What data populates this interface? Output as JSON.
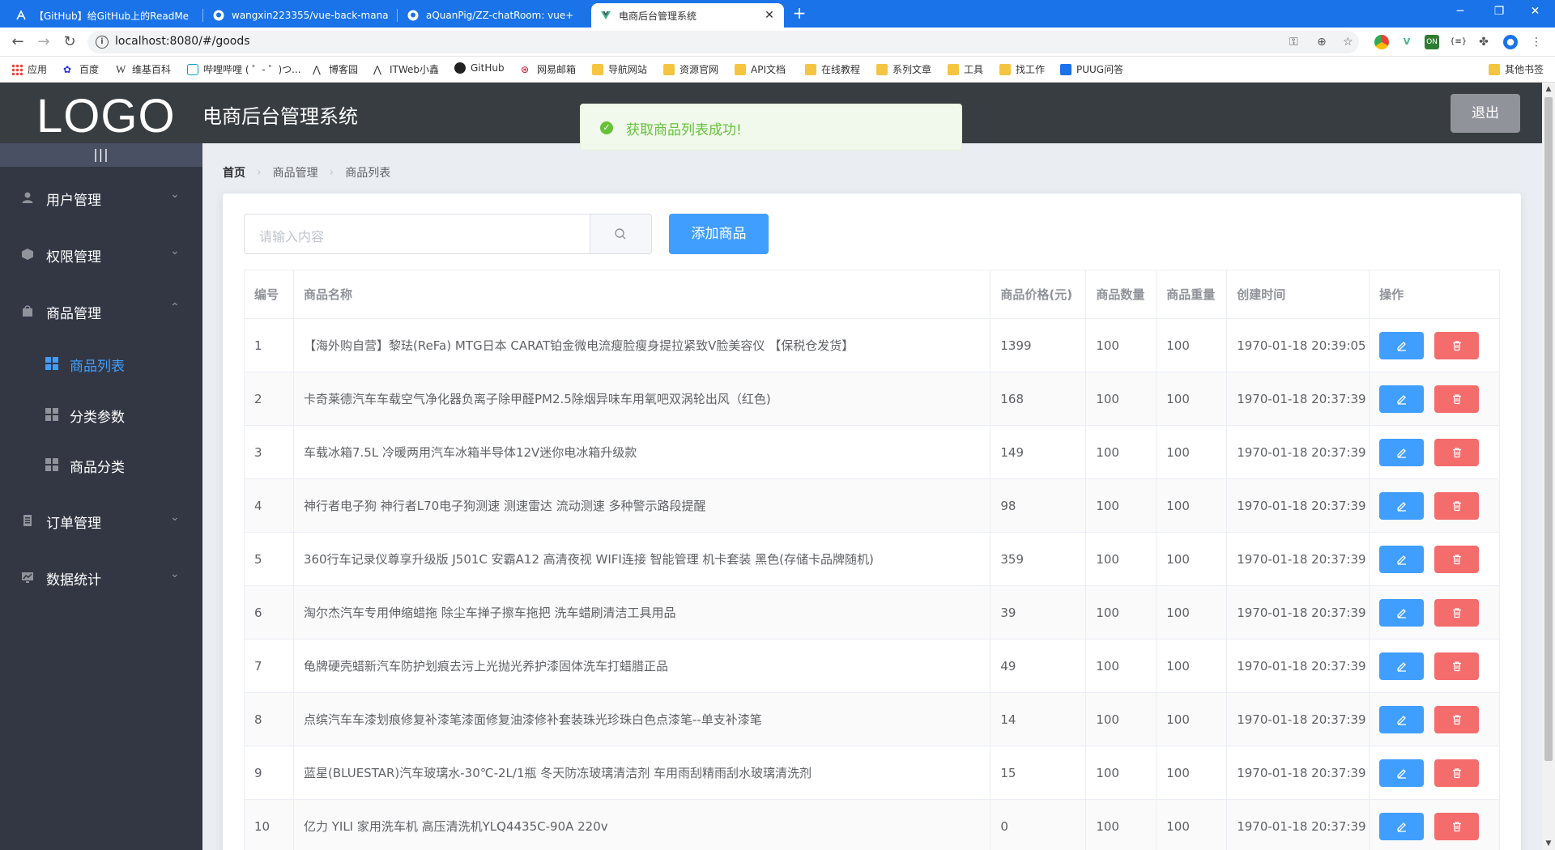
{
  "browser": {
    "tabs": [
      {
        "title": "【GitHub】给GitHub上的ReadMe",
        "icon": "aquanpig-icon",
        "active": false
      },
      {
        "title": "wangxin223355/vue-back-mana",
        "icon": "github-icon",
        "active": false
      },
      {
        "title": "aQuanPig/ZZ-chatRoom: vue+",
        "icon": "github-icon",
        "active": false
      },
      {
        "title": "电商后台管理系统",
        "icon": "vue-icon",
        "active": true
      }
    ],
    "new_tab": "+",
    "url": "localhost:8080/#/goods",
    "bookmarks": [
      {
        "label": "应用",
        "icon": "apps-icon"
      },
      {
        "label": "百度",
        "icon": "baidu-icon"
      },
      {
        "label": "维基百科",
        "icon": "wikipedia-icon"
      },
      {
        "label": "哔哩哔哩 ( ゜- ゜)つ...",
        "icon": "bilibili-icon"
      },
      {
        "label": "博客园",
        "icon": "cnblogs-icon"
      },
      {
        "label": "ITWeb小鑫",
        "icon": "itweb-icon"
      },
      {
        "label": "GitHub",
        "icon": "github-icon"
      },
      {
        "label": "网易邮箱",
        "icon": "netease-mail-icon"
      },
      {
        "label": "导航网站",
        "icon": "folder-icon"
      },
      {
        "label": "资源官网",
        "icon": "folder-icon"
      },
      {
        "label": "API文档",
        "icon": "folder-icon"
      },
      {
        "label": "在线教程",
        "icon": "folder-icon"
      },
      {
        "label": "系列文章",
        "icon": "folder-icon"
      },
      {
        "label": "工具",
        "icon": "folder-icon"
      },
      {
        "label": "找工作",
        "icon": "folder-icon"
      },
      {
        "label": "PUUG问答",
        "icon": "puug-icon"
      }
    ],
    "other_bookmarks": "其他书签"
  },
  "header": {
    "logo": "LOGO",
    "title": "电商后台管理系统",
    "logout": "退出"
  },
  "toast": {
    "message": "获取商品列表成功!",
    "color": "#67c23a"
  },
  "sidebar": {
    "toggle": "|||",
    "menus": [
      {
        "label": "用户管理",
        "icon": "user-icon",
        "arrow": "⌄"
      },
      {
        "label": "权限管理",
        "icon": "box-icon",
        "arrow": "⌄"
      },
      {
        "label": "商品管理",
        "icon": "bag-icon",
        "arrow": "⌃"
      },
      {
        "label": "订单管理",
        "icon": "document-icon",
        "arrow": "⌄"
      },
      {
        "label": "数据统计",
        "icon": "chart-icon",
        "arrow": "⌄"
      }
    ],
    "submenus": [
      {
        "label": "商品列表",
        "active": true
      },
      {
        "label": "分类参数",
        "active": false
      },
      {
        "label": "商品分类",
        "active": false
      }
    ],
    "active_color": "#409eff"
  },
  "breadcrumb": [
    "首页",
    "商品管理",
    "商品列表"
  ],
  "toolbar": {
    "search_placeholder": "请输入内容",
    "add_label": "添加商品"
  },
  "table": {
    "columns": [
      "编号",
      "商品名称",
      "商品价格(元)",
      "商品数量",
      "商品重量",
      "创建时间",
      "操作"
    ],
    "rows": [
      {
        "id": "1",
        "name": "【海外购自营】黎珐(ReFa) MTG日本 CARAT铂金微电流瘦脸瘦身提拉紧致V脸美容仪 【保税仓发货】",
        "price": "1399",
        "number": "100",
        "weight": "100",
        "time": "1970-01-18 20:39:05"
      },
      {
        "id": "2",
        "name": "卡奇莱德汽车车载空气净化器负离子除甲醛PM2.5除烟异味车用氧吧双涡轮出风（红色)",
        "price": "168",
        "number": "100",
        "weight": "100",
        "time": "1970-01-18 20:37:39"
      },
      {
        "id": "3",
        "name": "车载冰箱7.5L 冷暖两用汽车冰箱半导体12V迷你电冰箱升级款",
        "price": "149",
        "number": "100",
        "weight": "100",
        "time": "1970-01-18 20:37:39"
      },
      {
        "id": "4",
        "name": "神行者电子狗 神行者L70电子狗测速 测速雷达 流动测速 多种警示路段提醒",
        "price": "98",
        "number": "100",
        "weight": "100",
        "time": "1970-01-18 20:37:39"
      },
      {
        "id": "5",
        "name": "360行车记录仪尊享升级版 J501C 安霸A12 高清夜视 WIFI连接 智能管理 机卡套装 黑色(存储卡品牌随机)",
        "price": "359",
        "number": "100",
        "weight": "100",
        "time": "1970-01-18 20:37:39"
      },
      {
        "id": "6",
        "name": "淘尔杰汽车专用伸缩蜡拖 除尘车掸子擦车拖把 洗车蜡刷清洁工具用品",
        "price": "39",
        "number": "100",
        "weight": "100",
        "time": "1970-01-18 20:37:39"
      },
      {
        "id": "7",
        "name": "龟牌硬壳蜡新汽车防护划痕去污上光抛光养护漆固体洗车打蜡腊正品",
        "price": "49",
        "number": "100",
        "weight": "100",
        "time": "1970-01-18 20:37:39"
      },
      {
        "id": "8",
        "name": "点缤汽车车漆划痕修复补漆笔漆面修复油漆修补套装珠光珍珠白色点漆笔--单支补漆笔",
        "price": "14",
        "number": "100",
        "weight": "100",
        "time": "1970-01-18 20:37:39"
      },
      {
        "id": "9",
        "name": "蓝星(BLUESTAR)汽车玻璃水-30℃-2L/1瓶 冬天防冻玻璃清洁剂 车用雨刮精雨刮水玻璃清洗剂",
        "price": "15",
        "number": "100",
        "weight": "100",
        "time": "1970-01-18 20:37:39"
      },
      {
        "id": "10",
        "name": "亿力 YILI 家用洗车机 高压清洗机YLQ4435C-90A 220v",
        "price": "0",
        "number": "100",
        "weight": "100",
        "time": "1970-01-18 20:37:39"
      }
    ],
    "edit_color": "#409eff",
    "delete_color": "#f56c6c"
  }
}
